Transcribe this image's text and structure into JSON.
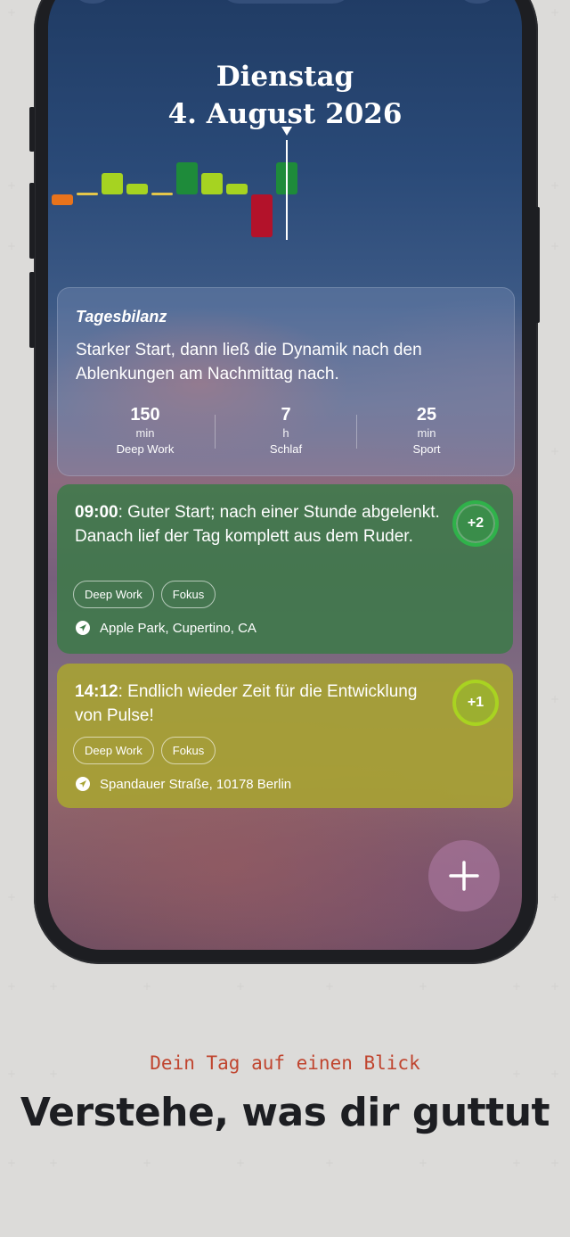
{
  "header": {
    "weekday": "Dienstag",
    "date": "4. August 2026"
  },
  "segments": [
    "timeline",
    "cards",
    "grid"
  ],
  "mood_chart": {
    "type": "bar",
    "values": [
      -1,
      0,
      2,
      1,
      0,
      3,
      2,
      1,
      -4,
      3
    ],
    "colors": [
      "#e8731c",
      "#e3c64a",
      "#a6d321",
      "#a6d321",
      "#e3c64a",
      "#1e8b3a",
      "#a6d321",
      "#a6d321",
      "#b3122a",
      "#1e8b3a"
    ]
  },
  "summary": {
    "heading": "Tagesbilanz",
    "description": "Starker Start, dann ließ die Dynamik nach den Ablenkungen am Nachmittag nach.",
    "stats": [
      {
        "value": "150",
        "unit": "min",
        "label": "Deep Work"
      },
      {
        "value": "7",
        "unit": "h",
        "label": "Schlaf"
      },
      {
        "value": "25",
        "unit": "min",
        "label": "Sport"
      }
    ]
  },
  "entries": [
    {
      "time": "09:00",
      "text": ": Guter Start; nach einer Stunde abgelenkt. Danach lief der Tag komplett aus dem Ruder.",
      "score": "+2",
      "tags": [
        "Deep Work",
        "Fokus"
      ],
      "location": "Apple Park, Cupertino, CA",
      "color": "#3c7a48"
    },
    {
      "time": "14:12",
      "text": ": Endlich wieder Zeit für die Entwicklung von Pulse!",
      "score": "+1",
      "tags": [
        "Deep Work",
        "Fokus"
      ],
      "location": "Spandauer Straße, 10178 Berlin",
      "color": "#a7a333"
    }
  ],
  "caption": {
    "subtitle": "Dein Tag auf einen Blick",
    "headline": "Verstehe, was dir guttut"
  },
  "icons": [
    "sparkles-icon",
    "timeline-icon",
    "cards-icon",
    "grid-icon",
    "gear-icon",
    "location-icon",
    "plus-icon"
  ]
}
